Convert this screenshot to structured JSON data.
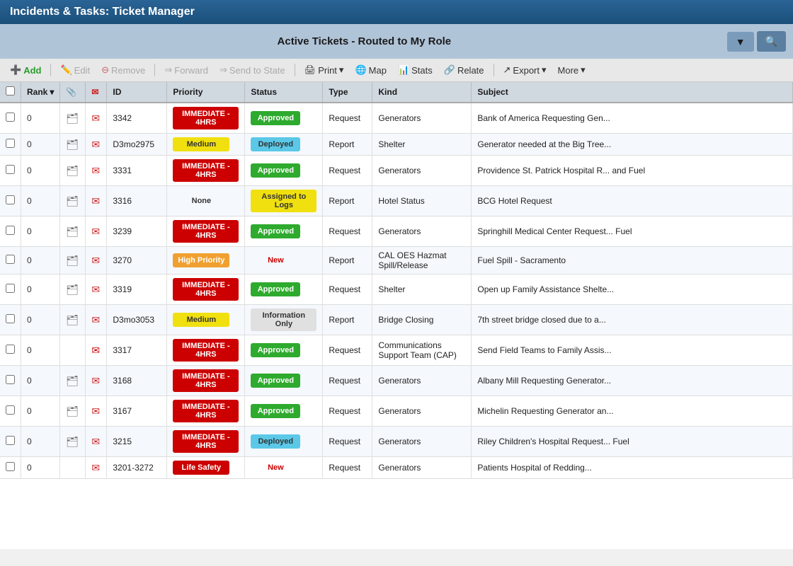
{
  "app": {
    "title": "Incidents & Tasks: Ticket Manager"
  },
  "header": {
    "view_title": "Active Tickets - Routed to My Role",
    "dropdown_label": "▼",
    "search_label": "🔍"
  },
  "toolbar": {
    "add": "Add",
    "edit": "Edit",
    "remove": "Remove",
    "forward": "Forward",
    "send_to_state": "Send to State",
    "print": "Print",
    "map": "Map",
    "stats": "Stats",
    "relate": "Relate",
    "export": "Export",
    "more": "More"
  },
  "columns": {
    "check": "",
    "rank": "Rank",
    "attach": "📎",
    "email": "✉",
    "id": "ID",
    "priority": "Priority",
    "status": "Status",
    "type": "Type",
    "kind": "Kind",
    "subject": "Subject"
  },
  "rows": [
    {
      "rank": "0",
      "id": "3342",
      "priority": "IMMEDIATE - 4HRS",
      "priority_class": "priority-immediate",
      "status": "Approved",
      "status_class": "status-approved",
      "type": "Request",
      "kind": "Generators",
      "subject": "Bank of America Requesting Gen...",
      "has_attach": true,
      "has_email": true,
      "email_special": false
    },
    {
      "rank": "0",
      "id": "D3mo2975",
      "priority": "Medium",
      "priority_class": "priority-medium",
      "status": "Deployed",
      "status_class": "status-deployed",
      "type": "Report",
      "kind": "Shelter",
      "subject": "Generator needed at the Big Tree...",
      "has_attach": true,
      "has_email": true,
      "email_special": false
    },
    {
      "rank": "0",
      "id": "3331",
      "priority": "IMMEDIATE - 4HRS",
      "priority_class": "priority-immediate",
      "status": "Approved",
      "status_class": "status-approved",
      "type": "Request",
      "kind": "Generators",
      "subject": "Providence St. Patrick Hospital R... and Fuel",
      "has_attach": true,
      "has_email": true,
      "email_special": false
    },
    {
      "rank": "0",
      "id": "3316",
      "priority": "None",
      "priority_class": "priority-none",
      "status": "Assigned to Logs",
      "status_class": "status-assigned",
      "type": "Report",
      "kind": "Hotel Status",
      "subject": "BCG Hotel Request",
      "has_attach": true,
      "has_email": true,
      "email_special": false
    },
    {
      "rank": "0",
      "id": "3239",
      "priority": "IMMEDIATE - 4HRS",
      "priority_class": "priority-immediate",
      "status": "Approved",
      "status_class": "status-approved",
      "type": "Request",
      "kind": "Generators",
      "subject": "Springhill Medical Center Request... Fuel",
      "has_attach": true,
      "has_email": true,
      "email_special": false
    },
    {
      "rank": "0",
      "id": "3270",
      "priority": "High Priority",
      "priority_class": "priority-high",
      "status": "New",
      "status_class": "status-new",
      "type": "Report",
      "kind": "CAL OES Hazmat Spill/Release",
      "subject": "Fuel Spill - Sacramento",
      "has_attach": true,
      "has_email": true,
      "email_special": false
    },
    {
      "rank": "0",
      "id": "3319",
      "priority": "IMMEDIATE - 4HRS",
      "priority_class": "priority-immediate",
      "status": "Approved",
      "status_class": "status-approved",
      "type": "Request",
      "kind": "Shelter",
      "subject": "Open up Family Assistance Shelte...",
      "has_attach": true,
      "has_email": true,
      "email_special": false
    },
    {
      "rank": "0",
      "id": "D3mo3053",
      "priority": "Medium",
      "priority_class": "priority-medium",
      "status": "Information Only",
      "status_class": "status-infoonly",
      "type": "Report",
      "kind": "Bridge Closing",
      "subject": "7th street bridge closed due to a...",
      "has_attach": true,
      "has_email": true,
      "email_special": false
    },
    {
      "rank": "0",
      "id": "3317",
      "priority": "IMMEDIATE - 4HRS",
      "priority_class": "priority-immediate",
      "status": "Approved",
      "status_class": "status-approved",
      "type": "Request",
      "kind": "Communications Support Team (CAP)",
      "subject": "Send Field Teams to Family Assis...",
      "has_attach": false,
      "has_email": true,
      "email_special": true
    },
    {
      "rank": "0",
      "id": "3168",
      "priority": "IMMEDIATE - 4HRS",
      "priority_class": "priority-immediate",
      "status": "Approved",
      "status_class": "status-approved",
      "type": "Request",
      "kind": "Generators",
      "subject": "Albany Mill Requesting Generator...",
      "has_attach": true,
      "has_email": true,
      "email_special": false
    },
    {
      "rank": "0",
      "id": "3167",
      "priority": "IMMEDIATE - 4HRS",
      "priority_class": "priority-immediate",
      "status": "Approved",
      "status_class": "status-approved",
      "type": "Request",
      "kind": "Generators",
      "subject": "Michelin Requesting Generator an...",
      "has_attach": true,
      "has_email": true,
      "email_special": false
    },
    {
      "rank": "0",
      "id": "3215",
      "priority": "IMMEDIATE - 4HRS",
      "priority_class": "priority-immediate",
      "status": "Deployed",
      "status_class": "status-deployed",
      "type": "Request",
      "kind": "Generators",
      "subject": "Riley Children's Hospital Request... Fuel",
      "has_attach": true,
      "has_email": true,
      "email_special": false
    },
    {
      "rank": "0",
      "id": "3201-3272",
      "priority": "Life Safety",
      "priority_class": "priority-lifesafety",
      "status": "New",
      "status_class": "status-new",
      "type": "Request",
      "kind": "Generators",
      "subject": "Patients Hospital of Redding...",
      "has_attach": false,
      "has_email": true,
      "email_special": false
    }
  ]
}
